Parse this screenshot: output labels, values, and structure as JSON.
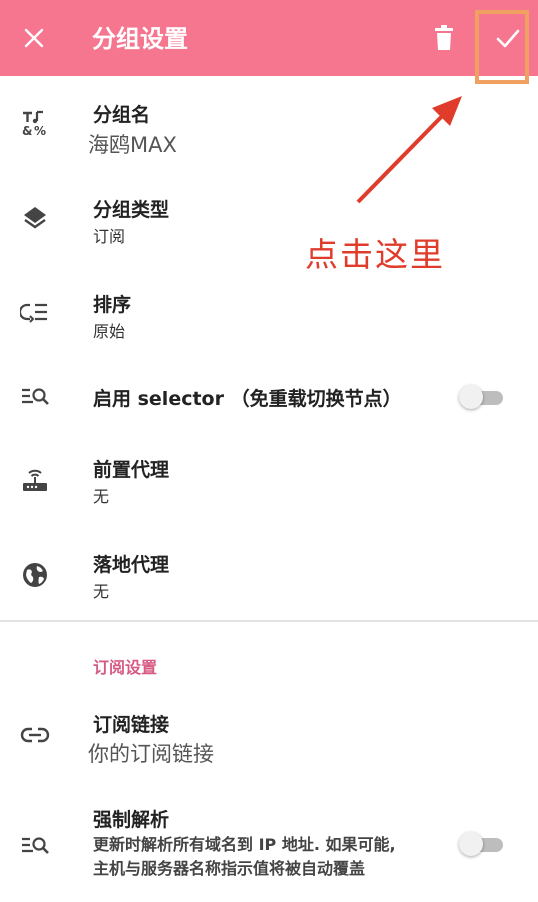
{
  "appbar": {
    "title": "分组设置",
    "close_icon": "close-icon",
    "delete_icon": "trash-icon",
    "confirm_icon": "check-icon",
    "color": "#f67690"
  },
  "annotation": {
    "text": "点击这里",
    "color": "#e03c2c",
    "highlight_color": "#f0a060"
  },
  "settings": {
    "group_name": {
      "label": "分组名",
      "value": "海鸥MAX",
      "icon": "text-format-icon"
    },
    "group_type": {
      "label": "分组类型",
      "value": "订阅",
      "icon": "layers-icon"
    },
    "sort": {
      "label": "排序",
      "value": "原始",
      "icon": "sort-icon"
    },
    "selector": {
      "label": "启用 selector （免重载切换节点）",
      "icon": "search-list-icon",
      "enabled": false
    },
    "front_proxy": {
      "label": "前置代理",
      "value": "无",
      "icon": "router-icon"
    },
    "landing_proxy": {
      "label": "落地代理",
      "value": "无",
      "icon": "globe-icon"
    }
  },
  "subscription": {
    "section_title": "订阅设置",
    "section_color": "#d65a82",
    "link": {
      "label": "订阅链接",
      "value": "你的订阅链接",
      "icon": "link-icon"
    },
    "force_resolve": {
      "label": "强制解析",
      "desc_line1": "更新时解析所有域名到 IP 地址. 如果可能,",
      "desc_line2": "主机与服务器名称指示值将被自动覆盖",
      "icon": "search-list-icon",
      "enabled": false
    }
  }
}
